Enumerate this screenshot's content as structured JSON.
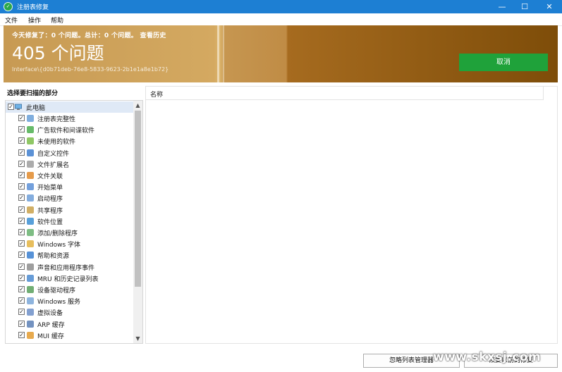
{
  "window": {
    "title": "注册表修复",
    "app_icon": "app-logo-icon"
  },
  "window_controls": {
    "minimize": "—",
    "maximize": "☐",
    "close": "✕"
  },
  "menu": [
    "文件",
    "操作",
    "帮助"
  ],
  "banner": {
    "stats": "今天修复了：0 个问题。总计：0 个问题。 查看历史",
    "count_text": "405 个问题",
    "interface": "Interface\\{d0b71deb-76e8-5833-9623-2b1e1a8e1b72}",
    "cancel_label": "取消"
  },
  "left_panel": {
    "heading": "选择要扫描的部分",
    "root": {
      "label": "此电脑",
      "icon": "computer-icon",
      "checked": true
    },
    "items": [
      {
        "label": "注册表完整性",
        "icon": "registry-icon",
        "checked": true
      },
      {
        "label": "广告软件和间谍软件",
        "icon": "spyware-icon",
        "checked": true
      },
      {
        "label": "未使用的软件",
        "icon": "trash-icon",
        "checked": true
      },
      {
        "label": "自定义控件",
        "icon": "controls-icon",
        "checked": true
      },
      {
        "label": "文件扩展名",
        "icon": "file-icon",
        "checked": true
      },
      {
        "label": "文件关联",
        "icon": "file-association-icon",
        "checked": true
      },
      {
        "label": "开始菜单",
        "icon": "start-menu-icon",
        "checked": true
      },
      {
        "label": "启动程序",
        "icon": "startup-icon",
        "checked": true
      },
      {
        "label": "共享程序",
        "icon": "shared-icon",
        "checked": true
      },
      {
        "label": "软件位置",
        "icon": "folder-icon",
        "checked": true
      },
      {
        "label": "添加/删除程序",
        "icon": "install-icon",
        "checked": true
      },
      {
        "label": "Windows 字体",
        "icon": "font-icon",
        "checked": true
      },
      {
        "label": "帮助和资源",
        "icon": "help-icon",
        "checked": true
      },
      {
        "label": "声音和应用程序事件",
        "icon": "sound-icon",
        "checked": true
      },
      {
        "label": "MRU 和历史记录列表",
        "icon": "history-icon",
        "checked": true
      },
      {
        "label": "设备驱动程序",
        "icon": "driver-icon",
        "checked": true
      },
      {
        "label": "Windows 服务",
        "icon": "service-icon",
        "checked": true
      },
      {
        "label": "虚拟设备",
        "icon": "virtual-device-icon",
        "checked": true
      },
      {
        "label": "ARP 缓存",
        "icon": "network-icon",
        "checked": true
      },
      {
        "label": "MUI 缓存",
        "icon": "mui-icon",
        "checked": true
      }
    ]
  },
  "right_panel": {
    "column_header": "名称"
  },
  "footer": {
    "ignore_list_button": "忽略列表管理器",
    "restore_button": "恢复以前的修复"
  },
  "watermark": "www.skxsj.com",
  "colors": {
    "titlebar": "#1d7fd3",
    "banner_left": "#d4a961",
    "banner_right": "#7e4d09",
    "cancel_green": "#1fa23a"
  }
}
